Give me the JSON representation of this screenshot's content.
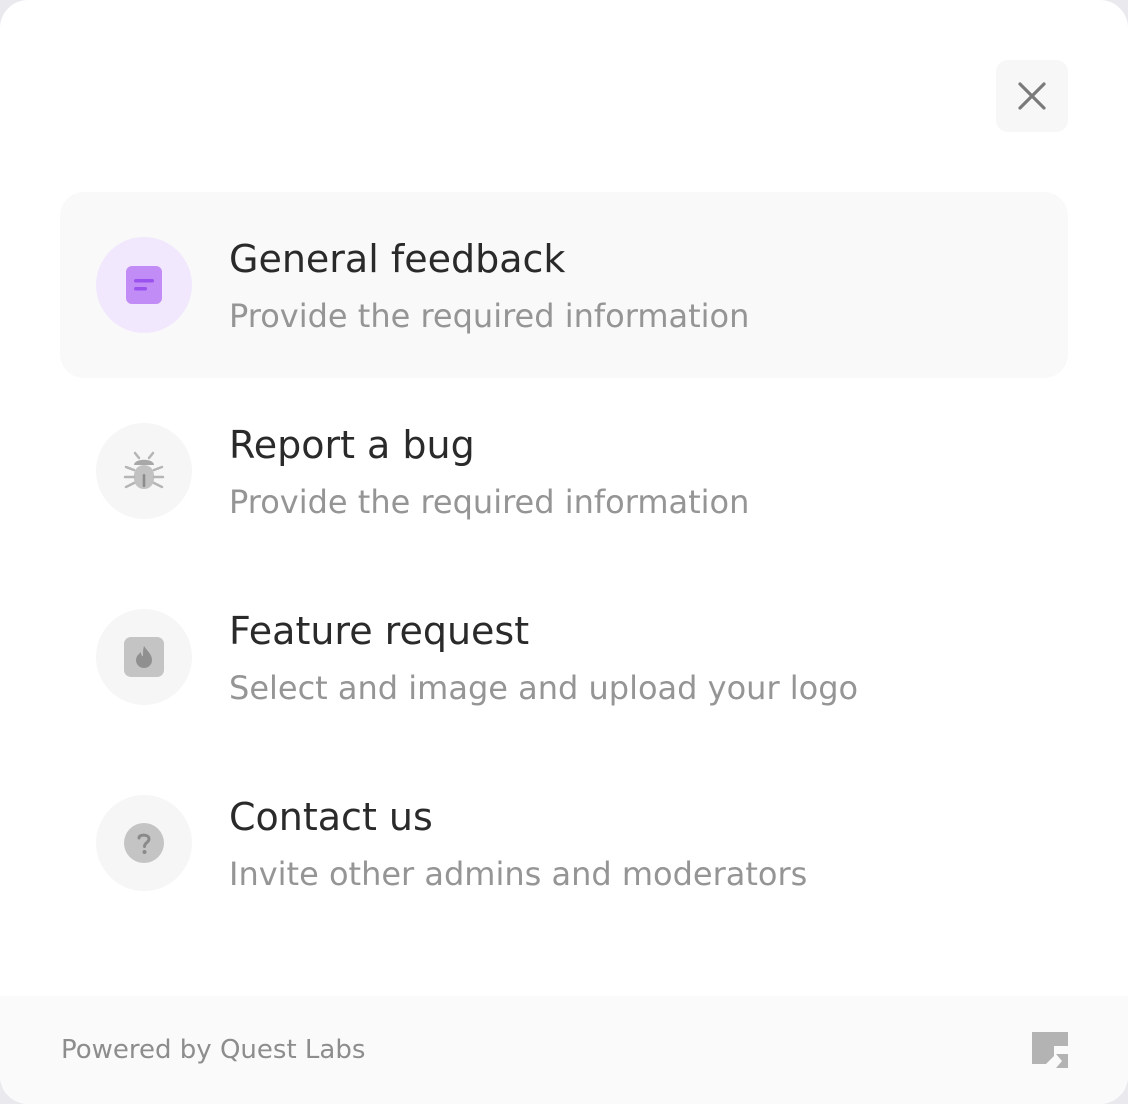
{
  "close_label": "×",
  "options": [
    {
      "title": "General feedback",
      "description": "Provide the required information",
      "icon": "feedback-icon",
      "active": true
    },
    {
      "title": "Report a bug",
      "description": "Provide the required information",
      "icon": "bug-icon",
      "active": false
    },
    {
      "title": "Feature request",
      "description": "Select and image and upload your logo",
      "icon": "feature-icon",
      "active": false
    },
    {
      "title": "Contact us",
      "description": "Invite other admins and moderators",
      "icon": "question-icon",
      "active": false
    }
  ],
  "footer": {
    "powered_by": "Powered by Quest Labs",
    "logo_icon": "quest-labs-logo-icon"
  },
  "colors": {
    "accent": "#c18cf6",
    "accent_bg": "#f1e8fd",
    "icon_gray": "#bdbdbd"
  }
}
